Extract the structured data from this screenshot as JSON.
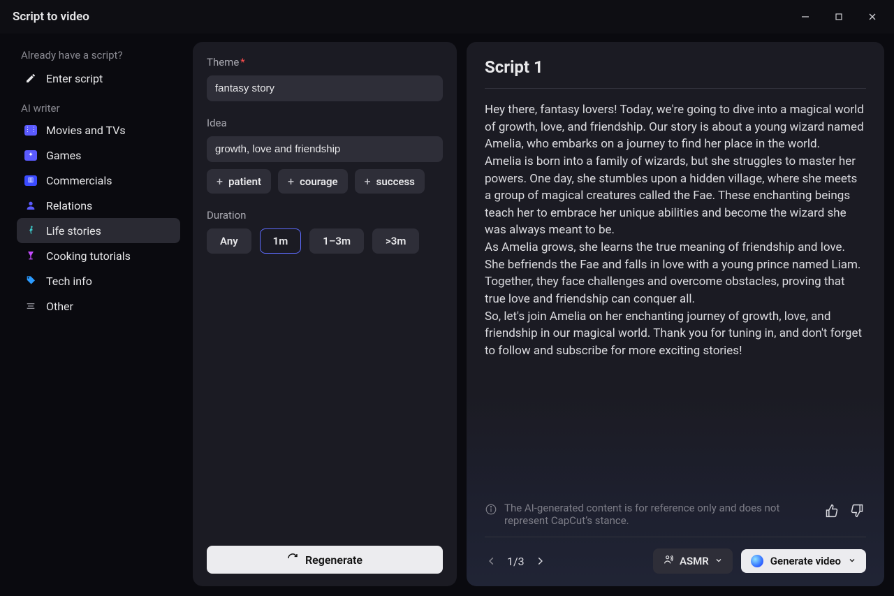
{
  "titlebar": {
    "title": "Script to video"
  },
  "sidebar": {
    "hint": "Already have a script?",
    "enter_script": "Enter script",
    "ai_writer_label": "AI writer",
    "items": [
      {
        "label": "Movies and TVs"
      },
      {
        "label": "Games"
      },
      {
        "label": "Commercials"
      },
      {
        "label": "Relations"
      },
      {
        "label": "Life stories"
      },
      {
        "label": "Cooking tutorials"
      },
      {
        "label": "Tech info"
      },
      {
        "label": "Other"
      }
    ]
  },
  "form": {
    "theme_label": "Theme",
    "theme_value": "fantasy story",
    "idea_label": "Idea",
    "idea_value": "growth, love and friendship",
    "chips": [
      {
        "label": "patient"
      },
      {
        "label": "courage"
      },
      {
        "label": "success"
      }
    ],
    "duration_label": "Duration",
    "durations": [
      {
        "label": "Any"
      },
      {
        "label": "1m"
      },
      {
        "label": "1–3m"
      },
      {
        "label": ">3m"
      }
    ],
    "regenerate_label": "Regenerate"
  },
  "script": {
    "title": "Script 1",
    "body": "Hey there, fantasy lovers! Today, we're going to dive into a magical world of growth, love, and friendship. Our story is about a young wizard named Amelia, who embarks on a journey to find her place in the world.\nAmelia is born into a family of wizards, but she struggles to master her powers. One day, she stumbles upon a hidden village, where she meets a group of magical creatures called the Fae. These enchanting beings teach her to embrace her unique abilities and become the wizard she was always meant to be.\nAs Amelia grows, she learns the true meaning of friendship and love. She befriends the Fae and falls in love with a young prince named Liam. Together, they face challenges and overcome obstacles, proving that true love and friendship can conquer all.\nSo, let's join Amelia on her enchanting journey of growth, love, and friendship in our magical world. Thank you for tuning in, and don't forget to follow and subscribe for more exciting stories!",
    "disclaimer": "The AI-generated content is for reference only and does not represent CapCut’s stance.",
    "pager": "1/3",
    "voice_label": "ASMR",
    "generate_label": "Generate video"
  }
}
